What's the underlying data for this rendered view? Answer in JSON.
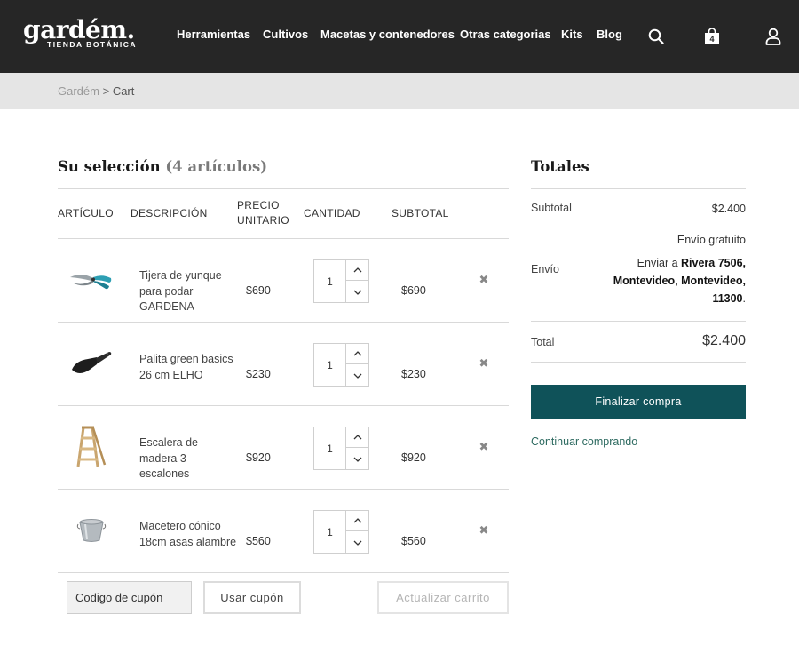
{
  "brand": {
    "name": "gardém.",
    "tagline": "TIENDA BOTÁNICA"
  },
  "nav": {
    "items": [
      "Herramientas",
      "Cultivos",
      "Macetas y contenedores",
      "Otras categorias",
      "Kits",
      "Blog"
    ]
  },
  "header_icons": {
    "search": "search-icon",
    "cart": "shopping-bag-icon",
    "cart_count": "4",
    "account": "user-icon"
  },
  "breadcrumb": {
    "home": "Gardém",
    "separator": ">",
    "current": "Cart"
  },
  "cart": {
    "title": "Su selección",
    "count_label": "(4 artículos)",
    "columns": {
      "item": "ARTÍCULO",
      "description": "DESCRIPCIÓN",
      "unit_price": "PRECIO UNITARIO",
      "quantity": "CANTIDAD",
      "subtotal": "SUBTOTAL"
    },
    "items": [
      {
        "description": "Tijera de yunque para podar GARDENA",
        "price": "$690",
        "qty": "1",
        "subtotal": "$690",
        "image": "pruning-shears"
      },
      {
        "description": "Palita green basics 26 cm ELHO",
        "price": "$230",
        "qty": "1",
        "subtotal": "$230",
        "image": "trowel"
      },
      {
        "description": "Escalera de madera 3 escalones",
        "price": "$920",
        "qty": "1",
        "subtotal": "$920",
        "image": "wooden-ladder"
      },
      {
        "description": "Macetero cónico 18cm asas alambre",
        "price": "$560",
        "qty": "1",
        "subtotal": "$560",
        "image": "metal-pot"
      }
    ],
    "remove_glyph": "✖",
    "coupon": {
      "placeholder": "Codigo de cupón",
      "apply_label": "Usar cupón"
    },
    "update_label": "Actualizar carrito"
  },
  "totals": {
    "title": "Totales",
    "subtotal_label": "Subtotal",
    "subtotal_value": "$2.400",
    "shipping_label": "Envío",
    "shipping_method": "Envío gratuito",
    "ship_to_prefix": "Enviar a",
    "ship_to_address": "Rivera 7506, Montevideo, Montevideo, 11300",
    "ship_to_suffix": ".",
    "total_label": "Total",
    "total_value": "$2.400",
    "checkout_label": "Finalizar compra",
    "continue_label": "Continuar comprando"
  },
  "colors": {
    "header_bg": "#262626",
    "crumb_bg": "#e5e5e5",
    "accent": "#0f5259",
    "link": "#2d6a60"
  }
}
